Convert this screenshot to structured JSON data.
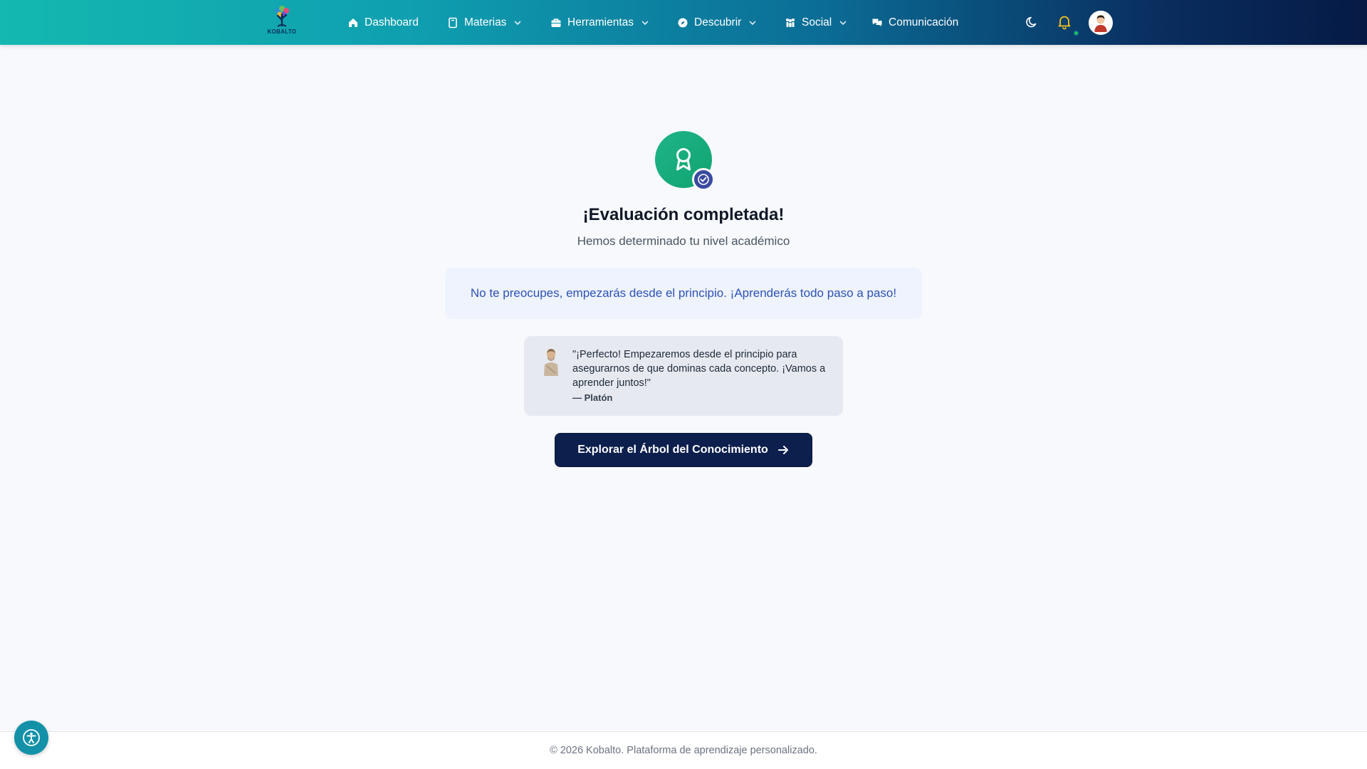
{
  "nav": {
    "logo_text": "KOBALTO",
    "items": [
      {
        "label": "Dashboard",
        "icon": "home-icon"
      },
      {
        "label": "Materias",
        "icon": "book-icon",
        "dropdown": true
      },
      {
        "label": "Herramientas",
        "icon": "briefcase-icon",
        "dropdown": true
      },
      {
        "label": "Descubrir",
        "icon": "compass-icon",
        "dropdown": true
      },
      {
        "label": "Social",
        "icon": "users-icon",
        "dropdown": true
      },
      {
        "label": "Comunicación",
        "icon": "chat-icon"
      }
    ],
    "right_icons": [
      "moon-icon",
      "bell-icon"
    ]
  },
  "result": {
    "title": "¡Evaluación completada!",
    "subtitle": "Hemos determinado tu nivel académico",
    "info": "No te preocupes, empezarás desde el principio. ¡Aprenderás todo paso a paso!"
  },
  "quote": {
    "text": "\"¡Perfecto! Empezaremos desde el principio para asegurarnos de que dominas cada concepto. ¡Vamos a aprender juntos!\"",
    "author": "— Platón"
  },
  "cta": {
    "label": "Explorar el Árbol del Conocimiento"
  },
  "footer": {
    "text": "© 2026 Kobalto. Plataforma de aprendizaje personalizado."
  },
  "colors": {
    "primary_dark": "#0d1f4d",
    "success": "#10a36f",
    "info_text": "#2d52b8",
    "notification_dot": "#22c55e"
  }
}
